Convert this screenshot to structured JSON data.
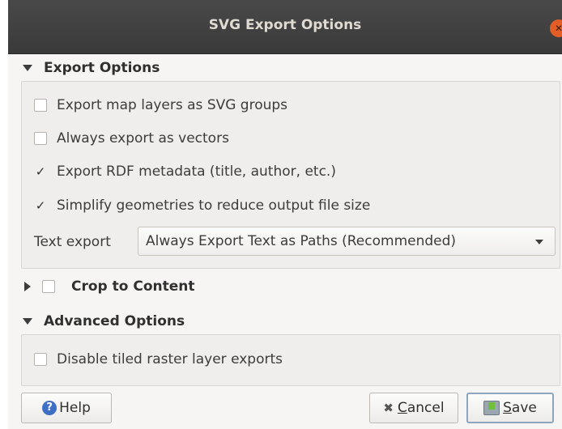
{
  "dialog": {
    "title": "SVG Export Options"
  },
  "export_options": {
    "header": "Export Options",
    "expanded": true,
    "checkboxes": [
      {
        "label": "Export map layers as SVG groups",
        "checked": false
      },
      {
        "label": "Always export as vectors",
        "checked": false
      },
      {
        "label": "Export RDF metadata (title, author, etc.)",
        "checked": true
      },
      {
        "label": "Simplify geometries to reduce output file size",
        "checked": true
      }
    ],
    "text_export": {
      "label": "Text export",
      "selected": "Always Export Text as Paths (Recommended)"
    }
  },
  "crop_to_content": {
    "header": "Crop to Content",
    "expanded": false,
    "checked": false
  },
  "advanced_options": {
    "header": "Advanced Options",
    "expanded": true,
    "checkboxes": [
      {
        "label": "Disable tiled raster layer exports",
        "checked": false
      }
    ]
  },
  "buttons": {
    "help": "Help",
    "cancel_mnemonic": "C",
    "cancel_rest": "ancel",
    "save_mnemonic": "S",
    "save_rest": "ave"
  },
  "icons": {
    "close": "close-icon",
    "help": "help-icon",
    "cancel": "cancel-icon",
    "save": "save-icon",
    "check": "✓"
  },
  "colors": {
    "titlebar": "#3a3a3a",
    "close_button": "#e35e27",
    "dialog_background": "#f6f5f4",
    "help_icon": "#3f6fc4"
  }
}
